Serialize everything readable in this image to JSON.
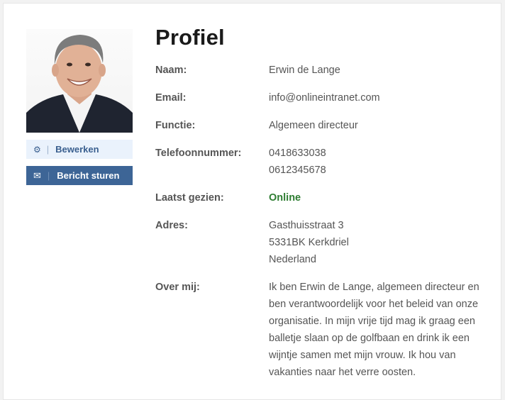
{
  "profile": {
    "title": "Profiel",
    "fields": {
      "name_label": "Naam:",
      "name": "Erwin de Lange",
      "email_label": "Email:",
      "email": "info@onlineintranet.com",
      "function_label": "Functie:",
      "function": "Algemeen directeur",
      "phone_label": "Telefoonnummer:",
      "phone_1": "0418633038",
      "phone_2": "0612345678",
      "last_seen_label": "Laatst gezien:",
      "last_seen": "Online",
      "address_label": "Adres:",
      "address_1": "Gasthuisstraat 3",
      "address_2": "5331BK Kerkdriel",
      "address_3": "Nederland",
      "about_label": "Over mij:",
      "about": "Ik ben Erwin de Lange, algemeen directeur en ben verantwoordelijk voor het beleid van onze organisatie. In mijn vrije tijd mag ik graag een balletje slaan op de golfbaan en drink ik een wijntje samen met mijn vrouw. Ik hou van vakanties naar het verre oosten."
    }
  },
  "actions": {
    "edit_label": "Bewerken",
    "edit_icon": "gears-icon",
    "message_label": "Bericht sturen",
    "message_icon": "envelope-icon"
  },
  "colors": {
    "online": "#2e7d32",
    "primary_button": "#3d6596",
    "secondary_button_bg": "#eaf2fc"
  }
}
